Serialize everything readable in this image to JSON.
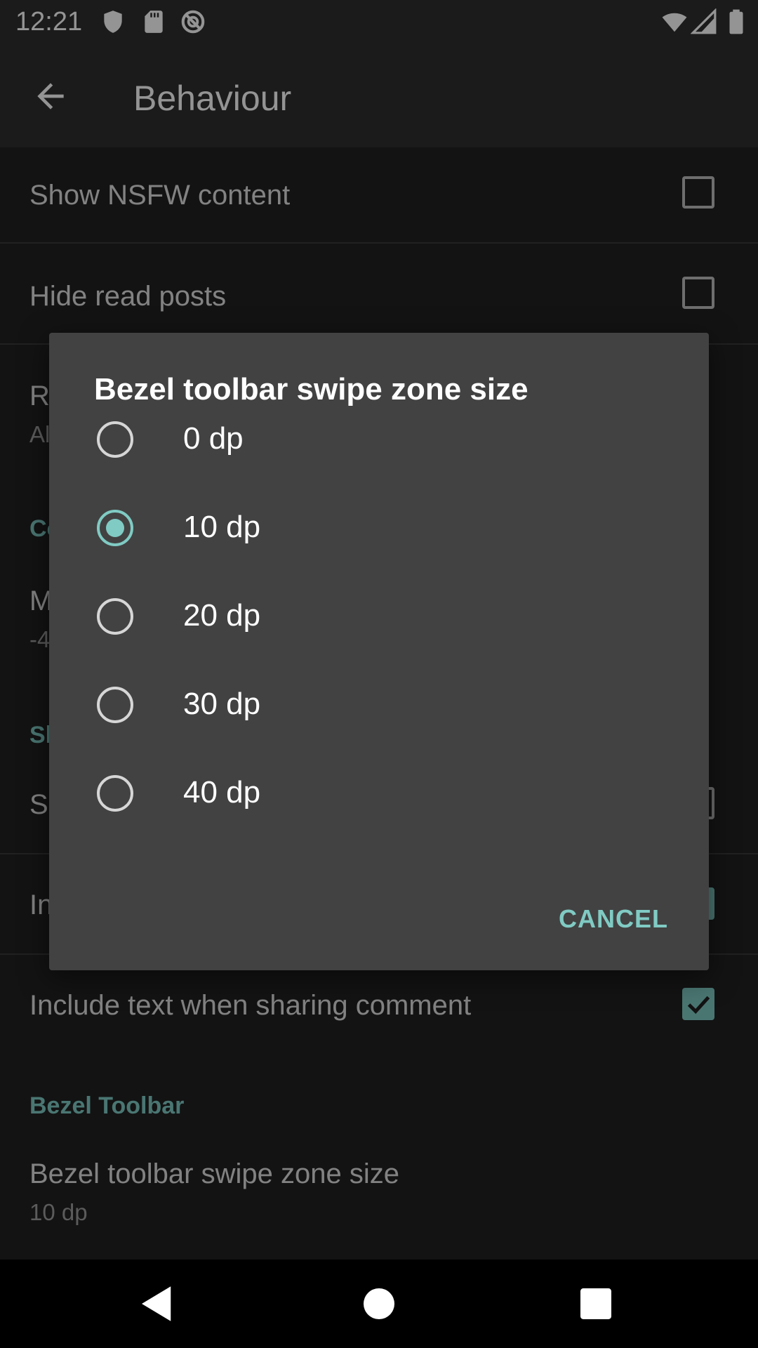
{
  "status_bar": {
    "time": "12:21",
    "left_icons": [
      "shield-icon",
      "sd-card-icon",
      "no-sync-icon"
    ],
    "right_icons": [
      "wifi-icon",
      "cellular-signal-icon",
      "battery-icon"
    ]
  },
  "app_bar": {
    "back_icon": "arrow-back-icon",
    "title": "Behaviour"
  },
  "preferences": {
    "show_nsfw": {
      "title": "Show NSFW content",
      "checked": false
    },
    "hide_read": {
      "title": "Hide read posts",
      "checked": false
    },
    "partial_rows": {
      "r_title": "R",
      "a_summary": "Al",
      "c_header": "Co",
      "m_title": "M",
      "minus_summary": "-4",
      "s_header": "Sl",
      "s_title": "S",
      "in_title": "In"
    },
    "include_text_comment": {
      "title": "Include text when sharing comment",
      "checked": true
    },
    "bezel_section": "Bezel Toolbar",
    "bezel_swipe": {
      "title": "Bezel toolbar swipe zone size",
      "summary": "10 dp"
    }
  },
  "dialog": {
    "title": "Bezel toolbar swipe zone size",
    "options": [
      {
        "label": "0 dp",
        "selected": false
      },
      {
        "label": "10 dp",
        "selected": true
      },
      {
        "label": "20 dp",
        "selected": false
      },
      {
        "label": "30 dp",
        "selected": false
      },
      {
        "label": "40 dp",
        "selected": false
      }
    ],
    "cancel_label": "CANCEL"
  },
  "nav_bar": {
    "buttons": [
      "back-triangle-icon",
      "home-circle-icon",
      "recents-square-icon"
    ]
  },
  "colors": {
    "accent": "#80cbc4",
    "dialog_bg": "#424242",
    "surface_bg": "#212121",
    "bar_bg": "#303030"
  }
}
